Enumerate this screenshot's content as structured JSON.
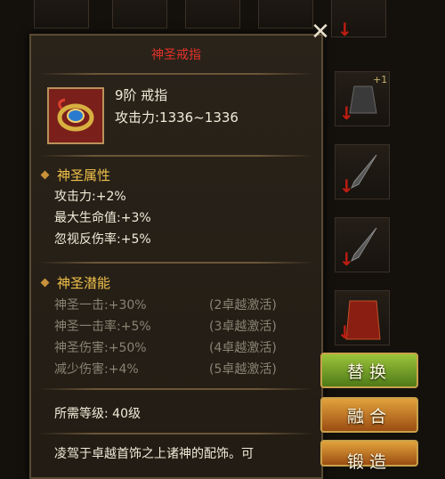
{
  "tooltip": {
    "title": "神圣戒指",
    "item": {
      "tier": "9阶  戒指",
      "attack": "攻击力:1336~1336"
    },
    "holy_attrs": {
      "heading": "神圣属性",
      "lines": [
        "攻击力:+2%",
        "最大生命值:+3%",
        "忽视反伤率:+5%"
      ]
    },
    "holy_potential": {
      "heading": "神圣潜能",
      "rows": [
        {
          "name": "神圣一击:+30%",
          "cond": "(2卓越激活)"
        },
        {
          "name": "神圣一击率:+5%",
          "cond": "(3卓越激活)"
        },
        {
          "name": "神圣伤害:+50%",
          "cond": "(4卓越激活)"
        },
        {
          "name": "减少伤害:+4%",
          "cond": "(5卓越激活)"
        }
      ]
    },
    "requirement": "所需等级: 40级",
    "description": "凌驾于卓越首饰之上诸神的配饰。可"
  },
  "buttons": {
    "replace": "替换",
    "fuse": "融合",
    "forge": "锻造"
  },
  "background": {
    "plus_label": "+1"
  },
  "icons": {
    "close": "close-icon",
    "section": "diamond-bullet-icon",
    "item": "ring-icon"
  }
}
